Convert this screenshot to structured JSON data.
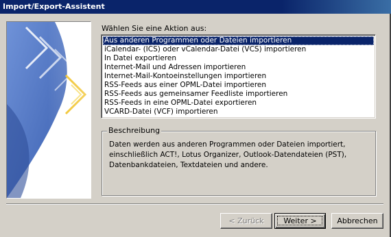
{
  "window": {
    "title": "Import/Export-Assistent"
  },
  "prompt": "Wählen Sie eine Aktion aus:",
  "actions": [
    {
      "label": "Aus anderen Programmen oder Dateien importieren",
      "selected": true
    },
    {
      "label": "iCalendar- (ICS) oder vCalendar-Datei (VCS) importieren",
      "selected": false
    },
    {
      "label": "In Datei exportieren",
      "selected": false
    },
    {
      "label": "Internet-Mail und Adressen importieren",
      "selected": false
    },
    {
      "label": "Internet-Mail-Kontoeinstellungen importieren",
      "selected": false
    },
    {
      "label": "RSS-Feeds aus einer OPML-Datei importieren",
      "selected": false
    },
    {
      "label": "RSS-Feeds aus gemeinsamer Feedliste importieren",
      "selected": false
    },
    {
      "label": "RSS-Feeds in eine OPML-Datei exportieren",
      "selected": false
    },
    {
      "label": "VCARD-Datei (VCF) importieren",
      "selected": false
    }
  ],
  "description": {
    "legend": "Beschreibung",
    "text": "Daten werden aus anderen Programmen oder Dateien importiert, einschließlich ACT!, Lotus Organizer, Outlook-Datendateien (PST), Datenbankdateien, Textdateien und andere."
  },
  "buttons": {
    "back": "< Zurück",
    "next": "Weiter >",
    "cancel": "Abbrechen"
  },
  "icons": {
    "wizard_art": "import-export-arrows-graphic"
  },
  "colors": {
    "title_bar": "#0a246a",
    "selection": "#0a246a",
    "dialog_face": "#d4d0c8",
    "art_blue": "#4a72c4",
    "art_arrow": "#f0c020"
  }
}
